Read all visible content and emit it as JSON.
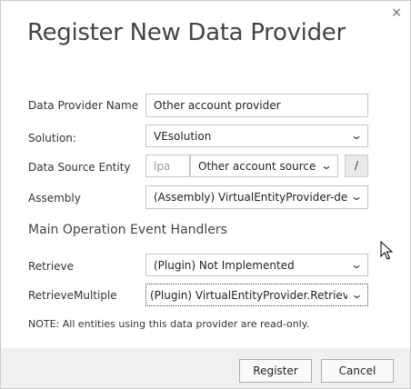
{
  "dialog": {
    "title": "Register New Data Provider",
    "close_glyph": "×"
  },
  "form": {
    "provider_name": {
      "label": "Data Provider Name",
      "value": "Other account provider"
    },
    "solution": {
      "label": "Solution:",
      "value": "VEsolution"
    },
    "data_source_entity": {
      "label": "Data Source Entity",
      "prefix_placeholder": "lpa_",
      "value": "Other account source",
      "slash_label": "/"
    },
    "assembly": {
      "label": "Assembly",
      "value": "(Assembly) VirtualEntityProvider-deploy"
    }
  },
  "handlers": {
    "section_title": "Main Operation Event Handlers",
    "retrieve": {
      "label": "Retrieve",
      "value": "(Plugin) Not Implemented"
    },
    "retrieve_multiple": {
      "label": "RetrieveMultiple",
      "value": "(Plugin) VirtualEntityProvider.RetrieveOther"
    }
  },
  "note": "NOTE: All entities using this data provider are read-only.",
  "footer": {
    "register_label": "Register",
    "cancel_label": "Cancel"
  },
  "icons": {
    "close": "close-icon",
    "chevron": "chevron-down-icon",
    "cursor": "mouse-cursor-icon"
  }
}
